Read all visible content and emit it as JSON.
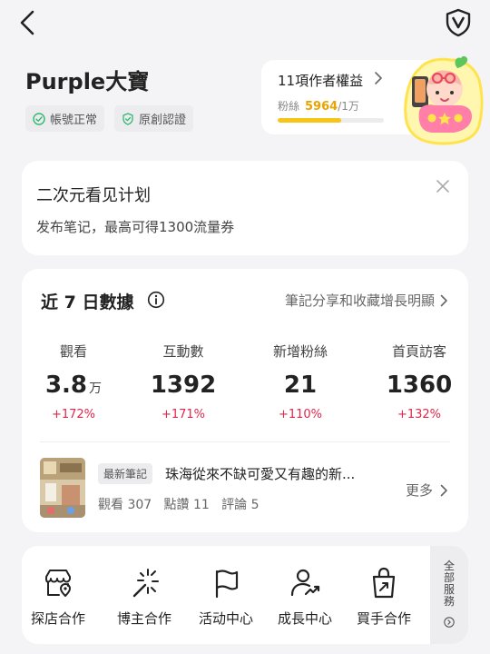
{
  "header": {
    "back_icon": "chevron-left-icon",
    "shield_icon": "shield-v-icon"
  },
  "profile": {
    "name": "Purple大寶",
    "badges": [
      {
        "label": "帳號正常",
        "icon": "check-circle-icon"
      },
      {
        "label": "原創認證",
        "icon": "shield-check-icon"
      }
    ]
  },
  "rights": {
    "title": "11項作者權益",
    "fans_label": "粉絲",
    "fans_value": "5964",
    "fans_target": "/1万",
    "progress": 0.5964,
    "accent": "#f5c518"
  },
  "promo": {
    "title": "二次元看见计划",
    "subtitle": "发布笔记，最高可得1300流量券"
  },
  "stats": {
    "title": "近 7 日數據",
    "link": "筆記分享和收藏增長明顯",
    "metrics": [
      {
        "label": "觀看",
        "value": "3.8",
        "unit": "万",
        "delta": "+172%"
      },
      {
        "label": "互動數",
        "value": "1392",
        "unit": "",
        "delta": "+171%"
      },
      {
        "label": "新增粉絲",
        "value": "21",
        "unit": "",
        "delta": "+110%"
      },
      {
        "label": "首頁訪客",
        "value": "1360",
        "unit": "",
        "delta": "+132%"
      }
    ],
    "delta_color": "#e0264a",
    "latest_note": {
      "tag": "最新筆記",
      "title": "珠海從來不缺可愛又有趣的新...",
      "meta": "觀看 307   點讚 11   評論 5",
      "more": "更多"
    }
  },
  "tools": [
    {
      "label": "探店合作",
      "icon": "store-pin-icon"
    },
    {
      "label": "博主合作",
      "icon": "magic-wand-icon"
    },
    {
      "label": "活动中心",
      "icon": "flag-icon"
    },
    {
      "label": "成長中心",
      "icon": "user-growth-icon"
    },
    {
      "label": "買手合作",
      "icon": "shopping-bag-icon"
    }
  ],
  "all_services": {
    "chars": [
      "全",
      "部",
      "服",
      "務"
    ]
  }
}
